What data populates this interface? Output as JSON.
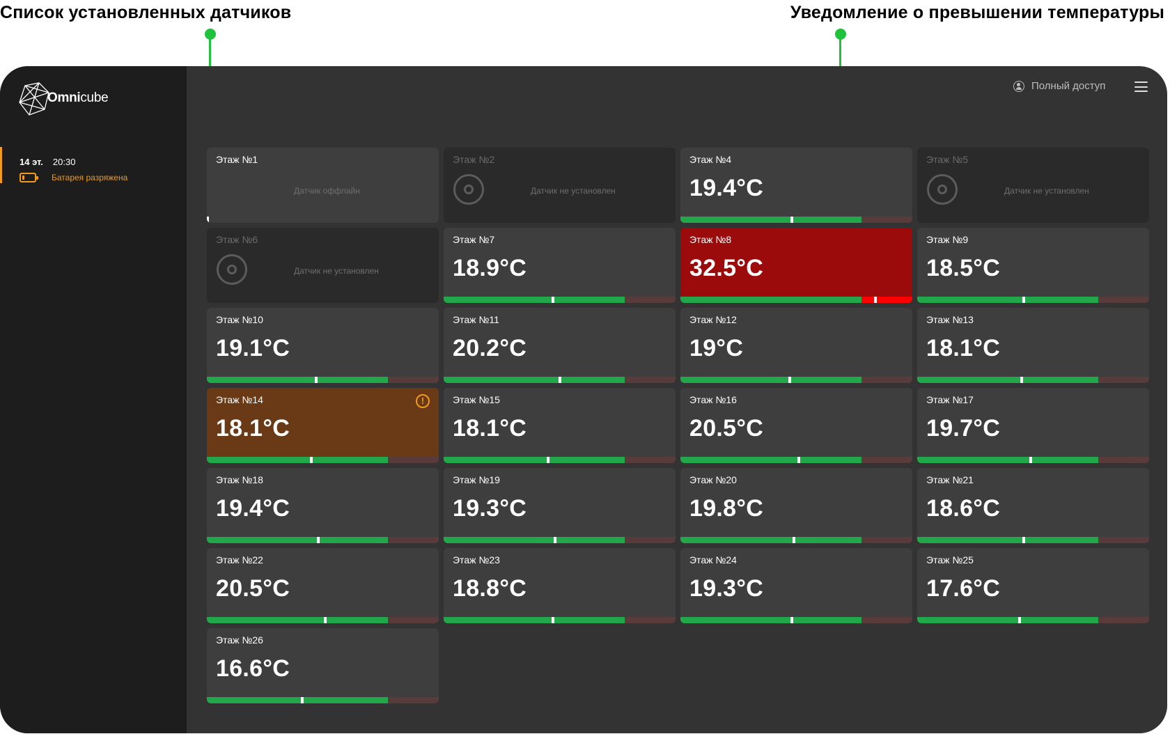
{
  "annotations": {
    "left": "Список установленных датчиков",
    "right": "Уведомление о превышении температуры"
  },
  "colors": {
    "accent_green": "#1fc23b",
    "alarm_red": "#9c0b0b",
    "warning_brown": "#6a3a16",
    "battery_orange": "#f29a1a",
    "bar_green": "#22a74b"
  },
  "app": {
    "logo_bold": "Omni",
    "logo_light": "cube",
    "access_label": "Полный доступ"
  },
  "notification": {
    "floor": "14 эт.",
    "time": "20:30",
    "status": "Батарея разряжена",
    "icon": "battery-low-icon"
  },
  "cards": [
    {
      "title": "Этаж №1",
      "state": "offline",
      "message": "Датчик оффлайн"
    },
    {
      "title": "Этаж №2",
      "state": "empty",
      "message": "Датчик не установлен"
    },
    {
      "title": "Этаж №4",
      "state": "normal",
      "temp": "19.4°C",
      "level": 0.48
    },
    {
      "title": "Этаж №5",
      "state": "empty",
      "message": "Датчик не установлен"
    },
    {
      "title": "Этаж №6",
      "state": "empty",
      "message": "Датчик не установлен"
    },
    {
      "title": "Этаж №7",
      "state": "normal",
      "temp": "18.9°C",
      "level": 0.47
    },
    {
      "title": "Этаж №8",
      "state": "alarm",
      "temp": "32.5°C",
      "level": 0.84
    },
    {
      "title": "Этаж №9",
      "state": "normal",
      "temp": "18.5°C",
      "level": 0.46
    },
    {
      "title": "Этаж №10",
      "state": "normal",
      "temp": "19.1°C",
      "level": 0.47
    },
    {
      "title": "Этаж №11",
      "state": "normal",
      "temp": "20.2°C",
      "level": 0.5
    },
    {
      "title": "Этаж №12",
      "state": "normal",
      "temp": "19°C",
      "level": 0.47
    },
    {
      "title": "Этаж №13",
      "state": "normal",
      "temp": "18.1°C",
      "level": 0.45
    },
    {
      "title": "Этаж №14",
      "state": "warning",
      "temp": "18.1°C",
      "level": 0.45
    },
    {
      "title": "Этаж №15",
      "state": "normal",
      "temp": "18.1°C",
      "level": 0.45
    },
    {
      "title": "Этаж №16",
      "state": "normal",
      "temp": "20.5°C",
      "level": 0.51
    },
    {
      "title": "Этаж №17",
      "state": "normal",
      "temp": "19.7°C",
      "level": 0.49
    },
    {
      "title": "Этаж №18",
      "state": "normal",
      "temp": "19.4°C",
      "level": 0.48
    },
    {
      "title": "Этаж №19",
      "state": "normal",
      "temp": "19.3°C",
      "level": 0.48
    },
    {
      "title": "Этаж №20",
      "state": "normal",
      "temp": "19.8°C",
      "level": 0.49
    },
    {
      "title": "Этаж №21",
      "state": "normal",
      "temp": "18.6°C",
      "level": 0.46
    },
    {
      "title": "Этаж №22",
      "state": "normal",
      "temp": "20.5°C",
      "level": 0.51
    },
    {
      "title": "Этаж №23",
      "state": "normal",
      "temp": "18.8°C",
      "level": 0.47
    },
    {
      "title": "Этаж №24",
      "state": "normal",
      "temp": "19.3°C",
      "level": 0.48
    },
    {
      "title": "Этаж №25",
      "state": "normal",
      "temp": "17.6°C",
      "level": 0.44
    },
    {
      "title": "Этаж №26",
      "state": "normal",
      "temp": "16.6°C",
      "level": 0.41
    }
  ]
}
